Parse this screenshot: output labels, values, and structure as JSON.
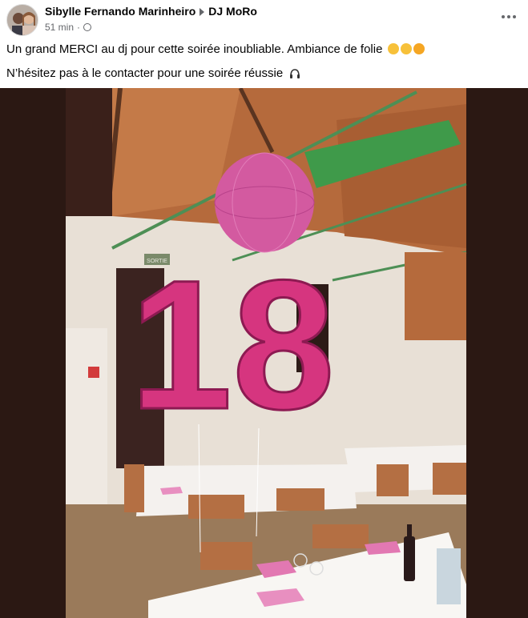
{
  "post": {
    "author": "Sibylle Fernando Marinheiro",
    "target_page": "DJ MoRo",
    "time": "51 min",
    "separator": "·",
    "lines": [
      "Un grand MERCI au dj pour cette soirée inoubliable. Ambiance de folie",
      "N’hésitez pas à le contacter pour une soirée réussie"
    ]
  },
  "photo": {
    "balloon_text": "18",
    "sign_text": "SORTIE"
  },
  "icons": {
    "avatar": "avatar-photo",
    "globe": "globe-icon",
    "more": "more-options-icon",
    "arrow": "right-arrow-icon",
    "emojis": [
      "smiling-face-with-hearts-icon",
      "partying-face-icon",
      "smiling-face-with-hearts-icon"
    ],
    "headphones": "headphones-icon"
  },
  "colors": {
    "text": "#050505",
    "secondary_text": "#65676b",
    "balloon_pink": "#d63a8a"
  }
}
